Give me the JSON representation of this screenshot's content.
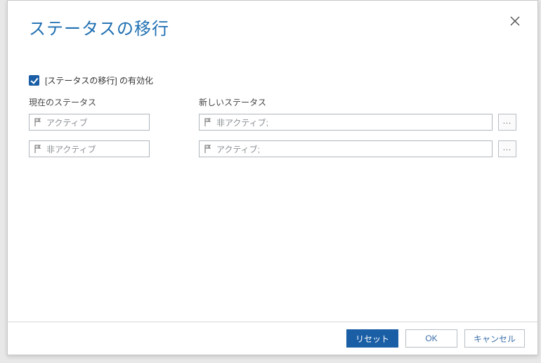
{
  "dialog": {
    "title": "ステータスの移行",
    "enable_checkbox_label": "[ステータスの移行] の有効化",
    "current_header": "現在のステータス",
    "new_header": "新しいステータス",
    "rows": [
      {
        "current": "アクティブ",
        "new": "非アクティブ;"
      },
      {
        "current": "非アクティブ",
        "new": "アクティブ;"
      }
    ],
    "ellipsis": "..."
  },
  "footer": {
    "reset": "リセット",
    "ok": "OK",
    "cancel": "キャンセル"
  }
}
